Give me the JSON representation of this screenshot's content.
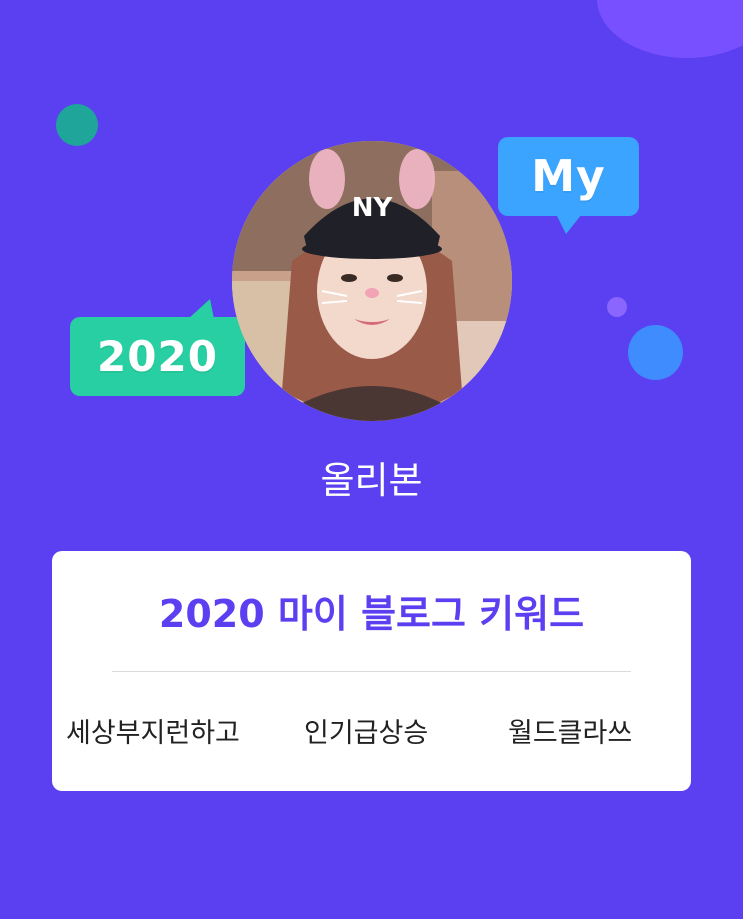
{
  "bubbles": {
    "my": "My",
    "year": "2020"
  },
  "profile": {
    "nickname": "올리본"
  },
  "card": {
    "title": "2020 마이 블로그 키워드",
    "keywords": [
      "세상부지런하고",
      "인기급상승",
      "월드클라쓰"
    ]
  },
  "colors": {
    "background": "#5a40f0",
    "accent": "#5b3ff0",
    "bubble_my": "#3aa4ff",
    "bubble_2020": "#28cfa2"
  }
}
